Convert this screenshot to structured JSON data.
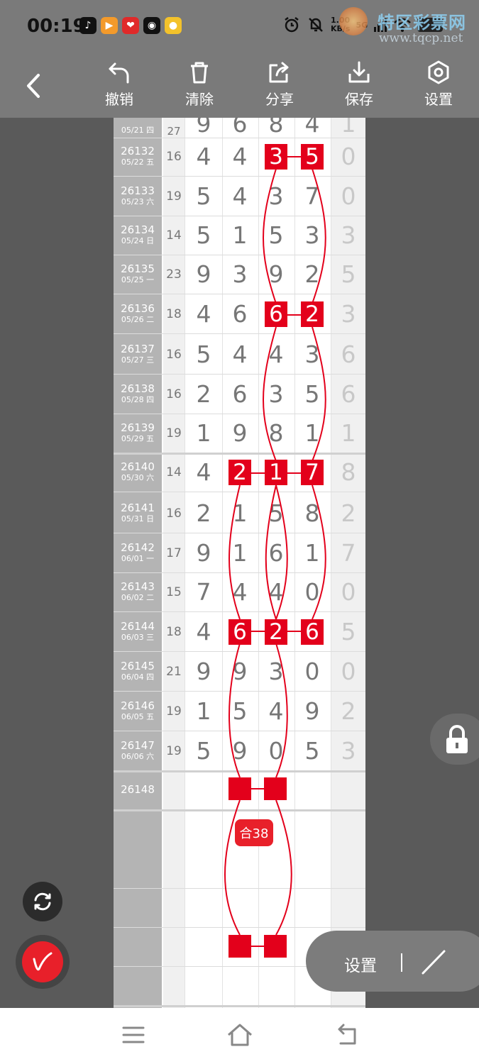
{
  "status_bar": {
    "time": "00:19",
    "speed_line1": "1.00",
    "speed_line2": "KB/s",
    "network": "5G"
  },
  "watermark": {
    "title": "特区彩票网",
    "url": "www.tqcp.net"
  },
  "toolbar": {
    "undo_label": "撤销",
    "clear_label": "清除",
    "share_label": "分享",
    "save_label": "保存",
    "settings_label": "设置"
  },
  "rows": [
    {
      "period": "",
      "date": "05/21 四",
      "sum": "27",
      "digits": [
        "9",
        "6",
        "8",
        "4"
      ],
      "tail": "1",
      "hl": [],
      "partial": true
    },
    {
      "period": "26132",
      "date": "05/22 五",
      "sum": "16",
      "digits": [
        "4",
        "4",
        "3",
        "5"
      ],
      "tail": "0",
      "hl": [
        2,
        3
      ]
    },
    {
      "period": "26133",
      "date": "05/23 六",
      "sum": "19",
      "digits": [
        "5",
        "4",
        "3",
        "7"
      ],
      "tail": "0",
      "hl": []
    },
    {
      "period": "26134",
      "date": "05/24 日",
      "sum": "14",
      "digits": [
        "5",
        "1",
        "5",
        "3"
      ],
      "tail": "3",
      "hl": []
    },
    {
      "period": "26135",
      "date": "05/25 一",
      "sum": "23",
      "digits": [
        "9",
        "3",
        "9",
        "2"
      ],
      "tail": "5",
      "hl": []
    },
    {
      "period": "26136",
      "date": "05/26 二",
      "sum": "18",
      "digits": [
        "4",
        "6",
        "6",
        "2"
      ],
      "tail": "3",
      "hl": [
        2,
        3
      ]
    },
    {
      "period": "26137",
      "date": "05/27 三",
      "sum": "16",
      "digits": [
        "5",
        "4",
        "4",
        "3"
      ],
      "tail": "6",
      "hl": []
    },
    {
      "period": "26138",
      "date": "05/28 四",
      "sum": "16",
      "digits": [
        "2",
        "6",
        "3",
        "5"
      ],
      "tail": "6",
      "hl": []
    },
    {
      "period": "26139",
      "date": "05/29 五",
      "sum": "19",
      "digits": [
        "1",
        "9",
        "8",
        "1"
      ],
      "tail": "1",
      "hl": []
    },
    {
      "period": "26140",
      "date": "05/30 六",
      "sum": "14",
      "digits": [
        "4",
        "2",
        "1",
        "7"
      ],
      "tail": "8",
      "hl": [
        1,
        2,
        3
      ]
    },
    {
      "period": "26141",
      "date": "05/31 日",
      "sum": "16",
      "digits": [
        "2",
        "1",
        "5",
        "8"
      ],
      "tail": "2",
      "hl": []
    },
    {
      "period": "26142",
      "date": "06/01 一",
      "sum": "17",
      "digits": [
        "9",
        "1",
        "6",
        "1"
      ],
      "tail": "7",
      "hl": []
    },
    {
      "period": "26143",
      "date": "06/02 二",
      "sum": "15",
      "digits": [
        "7",
        "4",
        "4",
        "0"
      ],
      "tail": "0",
      "hl": []
    },
    {
      "period": "26144",
      "date": "06/03 三",
      "sum": "18",
      "digits": [
        "4",
        "6",
        "2",
        "6"
      ],
      "tail": "5",
      "hl": [
        1,
        2,
        3
      ]
    },
    {
      "period": "26145",
      "date": "06/04 四",
      "sum": "21",
      "digits": [
        "9",
        "9",
        "3",
        "0"
      ],
      "tail": "0",
      "hl": []
    },
    {
      "period": "26146",
      "date": "06/05 五",
      "sum": "19",
      "digits": [
        "1",
        "5",
        "4",
        "9"
      ],
      "tail": "2",
      "hl": []
    },
    {
      "period": "26147",
      "date": "06/06 六",
      "sum": "19",
      "digits": [
        "5",
        "9",
        "0",
        "5"
      ],
      "tail": "3",
      "hl": []
    },
    {
      "period": "26148",
      "date": "",
      "sum": "",
      "digits": [
        "",
        "",
        "",
        ""
      ],
      "tail": "",
      "hl": []
    }
  ],
  "annotation": {
    "badge": "合38"
  },
  "settings_bar": {
    "label": "设置"
  },
  "colors": {
    "highlight": "#e3001b",
    "toolbar_bg": "#7a7a7a",
    "period_bg": "#b4b4b4"
  }
}
